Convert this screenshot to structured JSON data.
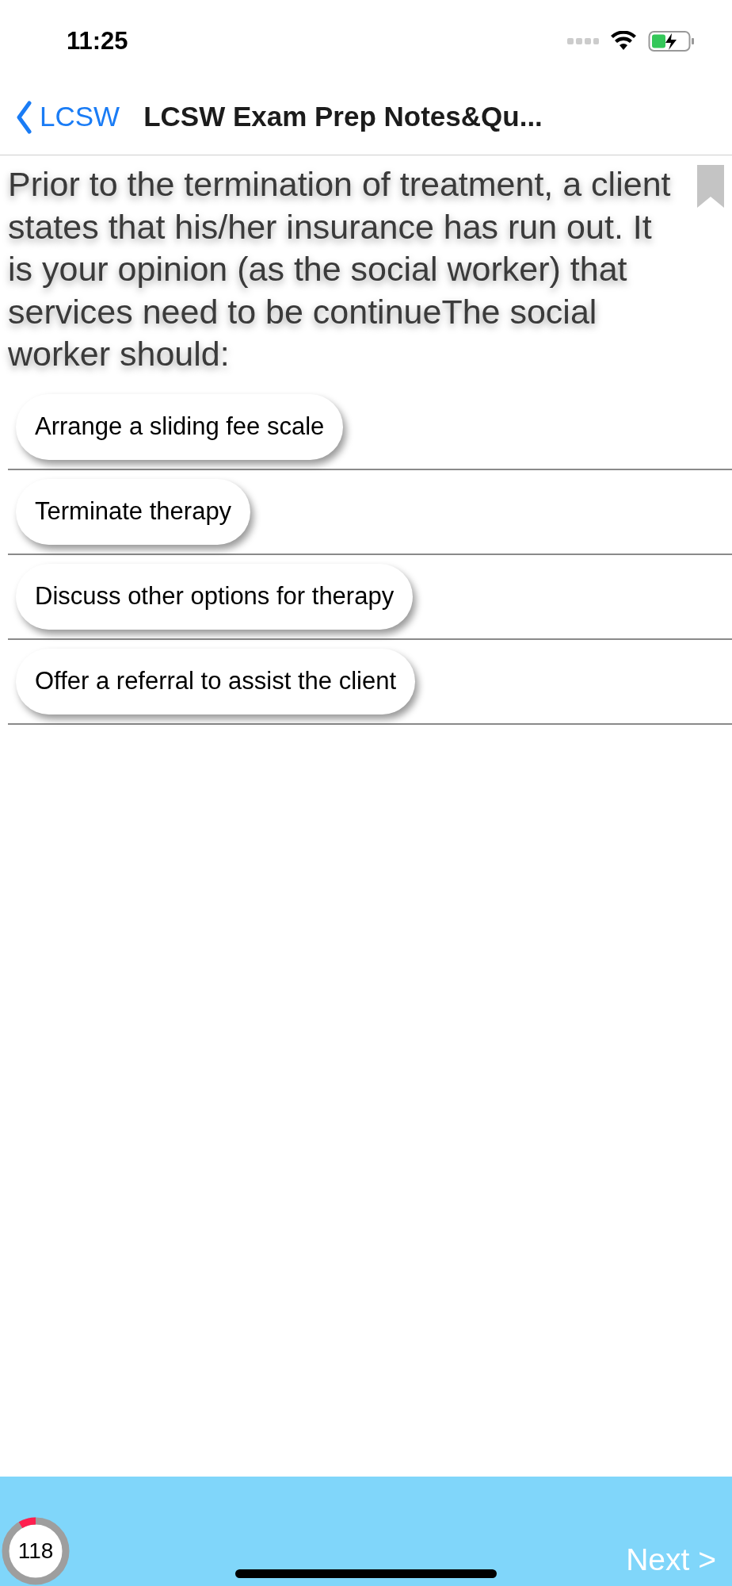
{
  "status_bar": {
    "time": "11:25"
  },
  "nav_bar": {
    "back_label": "LCSW",
    "title": "LCSW Exam Prep Notes&Qu..."
  },
  "question": {
    "text": "Prior to the termination of treatment, a client states that his/her insurance has run out. It is your opinion (as the social worker) that services need to be continueThe social worker should:",
    "bookmarked": false
  },
  "options": [
    {
      "label": "Arrange a sliding fee scale"
    },
    {
      "label": "Terminate therapy"
    },
    {
      "label": "Discuss other options for therapy"
    },
    {
      "label": "Offer a referral to assist the client"
    }
  ],
  "footer": {
    "progress": {
      "count": "118"
    },
    "next_label": "Next >"
  }
}
